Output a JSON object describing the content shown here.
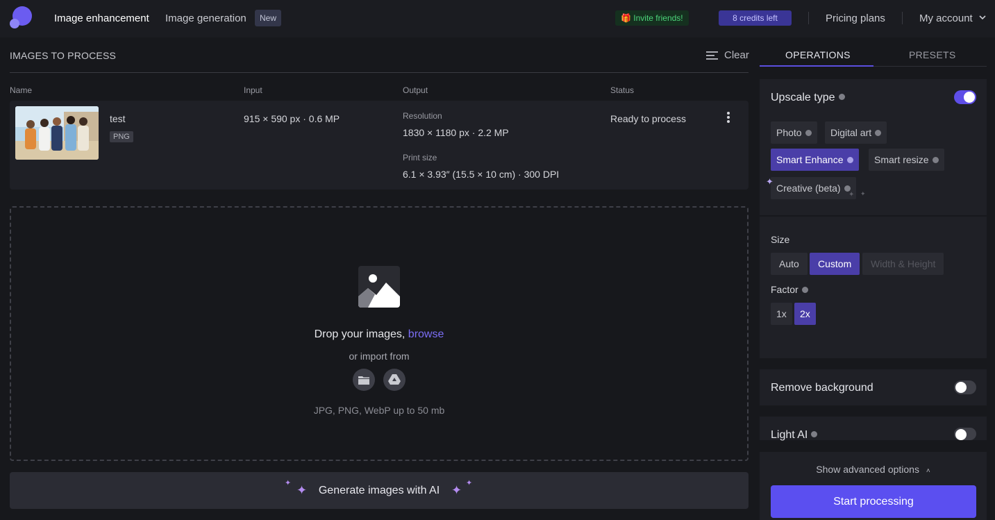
{
  "header": {
    "nav": {
      "image_enhancement": "Image enhancement",
      "image_generation": "Image generation",
      "new_badge": "New"
    },
    "invite": "🎁 Invite friends!",
    "credits": "8 credits left",
    "pricing": "Pricing plans",
    "account": "My account"
  },
  "images": {
    "title": "IMAGES TO PROCESS",
    "clear": "Clear",
    "columns": {
      "name": "Name",
      "input": "Input",
      "output": "Output",
      "status": "Status"
    },
    "rows": [
      {
        "name": "test",
        "format": "PNG",
        "input": "915 × 590 px · 0.6 MP",
        "resolution_label": "Resolution",
        "resolution": "1830 × 1180 px · 2.2 MP",
        "print_label": "Print size",
        "print_size": "6.1 × 3.93″ (15.5 × 10 cm) · 300 DPI",
        "status": "Ready to process"
      }
    ]
  },
  "dropzone": {
    "text": "Drop your images, ",
    "browse": "browse",
    "import": "or import from",
    "formats": "JPG, PNG, WebP up to 50 mb",
    "import_icons": [
      "folder-icon",
      "google-drive-icon"
    ]
  },
  "generate": {
    "label": "Generate images with AI"
  },
  "panel": {
    "tabs": {
      "operations": "OPERATIONS",
      "presets": "PRESETS"
    },
    "upscale": {
      "title": "Upscale type",
      "enabled": true,
      "types": [
        "Photo",
        "Digital art",
        "Smart Enhance",
        "Smart resize",
        "Creative (beta)"
      ],
      "selected": "Smart Enhance"
    },
    "size": {
      "label": "Size",
      "options": [
        "Auto",
        "Custom",
        "Width & Height"
      ],
      "selected": "Custom",
      "factor_label": "Factor",
      "factors": [
        "1x",
        "2x"
      ],
      "factor_selected": "2x"
    },
    "remove_background": {
      "title": "Remove background",
      "enabled": false
    },
    "light_ai": {
      "title": "Light AI",
      "enabled": false
    },
    "advanced": "Show advanced options",
    "start": "Start processing"
  },
  "colors": {
    "accent": "#5b4ff0",
    "selected_chip": "#4a3ea8",
    "invite_green": "#4cd47a",
    "browse_link": "#7b6ef5"
  }
}
